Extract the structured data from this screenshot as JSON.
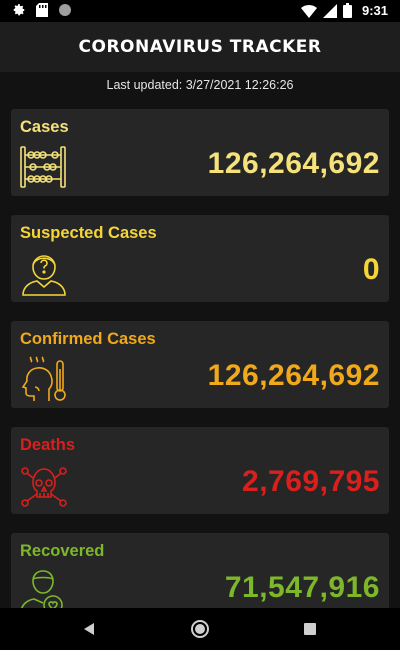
{
  "status_bar": {
    "time": "9:31",
    "left_icons": [
      "gear-icon",
      "sd-card-icon",
      "circle-icon"
    ],
    "right_icons": [
      "wifi-icon",
      "signal-icon",
      "battery-icon"
    ]
  },
  "app": {
    "title": "CORONAVIRUS TRACKER"
  },
  "last_updated": "Last updated: 3/27/2021 12:26:26",
  "cards": [
    {
      "title": "Cases",
      "value": "126,264,692",
      "color": "#f5e27a",
      "icon": "abacus-icon"
    },
    {
      "title": "Suspected Cases",
      "value": "0",
      "color": "#f5d63a",
      "icon": "confused-person-icon"
    },
    {
      "title": "Confirmed Cases",
      "value": "126,264,692",
      "color": "#f0a91a",
      "icon": "fever-thermometer-icon"
    },
    {
      "title": "Deaths",
      "value": "2,769,795",
      "color": "#d9201c",
      "icon": "skull-crossbones-icon"
    },
    {
      "title": "Recovered",
      "value": "71,547,916",
      "color": "#7cb82a",
      "icon": "recovered-person-icon"
    }
  ],
  "nav_bar": {
    "buttons": [
      "back-icon",
      "home-icon",
      "recents-icon"
    ]
  }
}
